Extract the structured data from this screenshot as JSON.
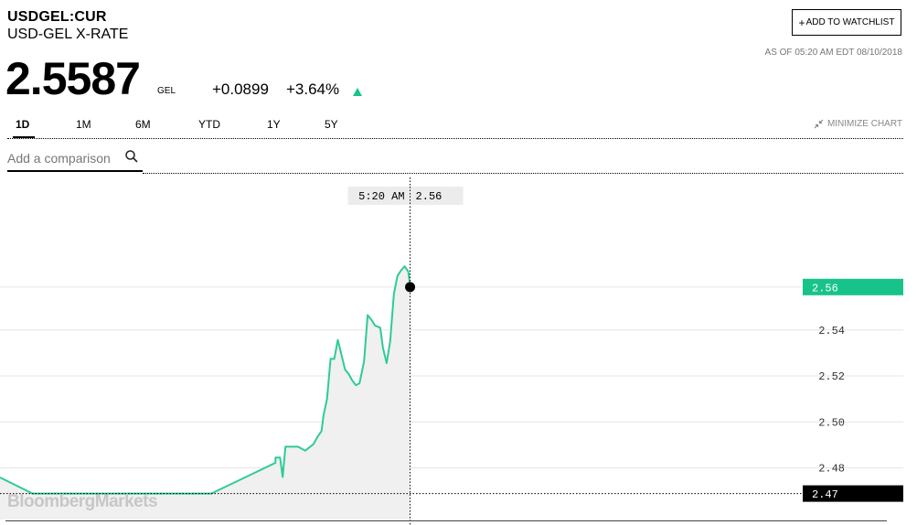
{
  "header": {
    "ticker": "USDGEL:CUR",
    "name": "USD-GEL X-RATE",
    "price": "2.5587",
    "currency": "GEL",
    "change": "+0.0899",
    "change_pct": "+3.64%",
    "watchlist_label": "ADD TO WATCHLIST",
    "as_of": "AS OF 05:20 AM EDT 08/10/2018"
  },
  "colors": {
    "accent": "#17c38b",
    "line": "#2ecb94",
    "fill": "#f0f0f0"
  },
  "tabs": [
    {
      "label": "1D",
      "active": true
    },
    {
      "label": "1M"
    },
    {
      "label": "6M"
    },
    {
      "label": "YTD"
    },
    {
      "label": "1Y"
    },
    {
      "label": "5Y"
    }
  ],
  "minimize_label": "MINIMIZE CHART",
  "compare": {
    "placeholder": "Add a comparison"
  },
  "chart_data": {
    "type": "area",
    "ylim": [
      2.4575,
      2.608
    ],
    "xlim": [
      0,
      1
    ],
    "ticks": [
      "2.48",
      "2.50",
      "2.52",
      "2.54"
    ],
    "tick_values": [
      2.48,
      2.5,
      2.52,
      2.54
    ],
    "current": {
      "label": "2.56",
      "value": 2.5587,
      "x": 0.454
    },
    "previous_close": {
      "label": "2.47",
      "value": 2.4688
    },
    "crosshair": {
      "time": "5:20 AM",
      "value": "2.56"
    },
    "grid": true,
    "watermark": "BloombergMarkets",
    "series": [
      {
        "x": [
          0.0,
          0.036,
          0.234,
          0.305,
          0.305,
          0.31,
          0.313,
          0.316,
          0.33,
          0.338,
          0.347,
          0.352,
          0.356,
          0.358,
          0.362,
          0.366,
          0.37,
          0.374,
          0.382,
          0.386,
          0.39,
          0.394,
          0.398,
          0.403,
          0.407,
          0.412,
          0.415,
          0.421,
          0.424,
          0.428,
          0.432,
          0.436,
          0.44,
          0.444,
          0.448,
          0.452,
          0.454
        ],
        "y": [
          2.4758,
          2.4688,
          2.4688,
          2.4822,
          2.4845,
          2.4845,
          2.476,
          2.4892,
          2.4892,
          2.4875,
          2.4903,
          2.4938,
          2.496,
          2.5025,
          2.51,
          2.5275,
          2.5274,
          2.5357,
          2.5228,
          2.5208,
          2.518,
          2.516,
          2.5168,
          2.5263,
          2.5465,
          2.544,
          2.542,
          2.541,
          2.5321,
          2.5256,
          2.5352,
          2.5556,
          2.5635,
          2.566,
          2.5677,
          2.5654,
          2.5587
        ]
      }
    ]
  }
}
